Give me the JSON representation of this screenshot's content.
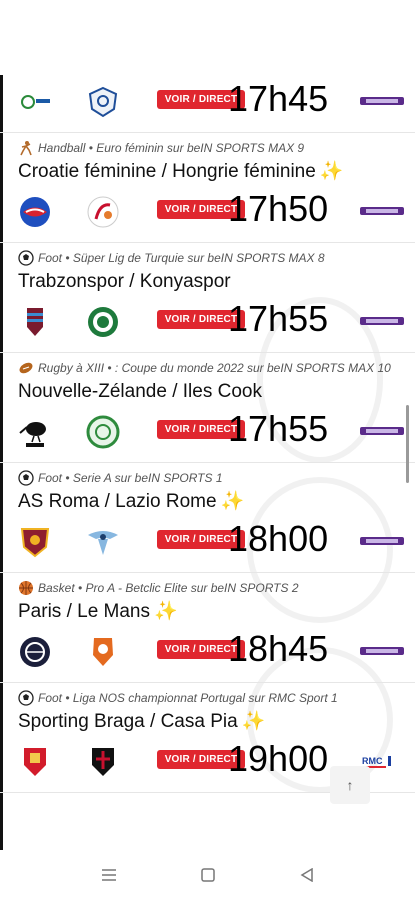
{
  "colors": {
    "accent": "#e0262f",
    "star": "#f2c200"
  },
  "first_row": {
    "button_label": "VOIR / DIRECT",
    "time": "17h45",
    "home_logo_icon": "club-crest-icon",
    "away_logo_icon": "crest-icon",
    "channel_icon": "bein-sports-icon"
  },
  "matches": [
    {
      "sport_icon": "handball-icon",
      "meta": "Handball • Euro féminin sur beIN SPORTS MAX 9",
      "teams": "Croatie féminine / Hongrie féminine",
      "star": "✨",
      "button_label": "VOIR / DIRECT",
      "time": "17h50",
      "home_logo_icon": "croatia-federation-icon",
      "away_logo_icon": "hungary-handball-icon",
      "channel_icon": "bein-sports-icon"
    },
    {
      "sport_icon": "football-icon",
      "meta": "Foot • Süper Lig de Turquie sur beIN SPORTS MAX 8",
      "teams": "Trabzonspor / Konyaspor",
      "star": "",
      "button_label": "VOIR / DIRECT",
      "time": "17h55",
      "home_logo_icon": "trabzonspor-crest-icon",
      "away_logo_icon": "konyaspor-crest-icon",
      "channel_icon": "bein-sports-icon"
    },
    {
      "sport_icon": "rugby-icon",
      "meta": "Rugby à XIII • : Coupe du monde 2022 sur beIN SPORTS MAX 10",
      "teams": "Nouvelle-Zélande / Iles Cook",
      "star": "",
      "button_label": "VOIR / DIRECT",
      "time": "17h55",
      "home_logo_icon": "kiwis-logo-icon",
      "away_logo_icon": "cook-islands-crest-icon",
      "channel_icon": "bein-sports-icon"
    },
    {
      "sport_icon": "football-icon",
      "meta": "Foot • Serie A sur beIN SPORTS 1",
      "teams": "AS Roma / Lazio Rome",
      "star": "✨",
      "button_label": "VOIR / DIRECT",
      "time": "18h00",
      "home_logo_icon": "as-roma-crest-icon",
      "away_logo_icon": "lazio-eagle-icon",
      "channel_icon": "bein-sports-icon"
    },
    {
      "sport_icon": "basketball-icon",
      "meta": "Basket • Pro A - Betclic Elite sur beIN SPORTS 2",
      "teams": "Paris / Le Mans",
      "star": "✨",
      "button_label": "VOIR / DIRECT",
      "time": "18h45",
      "home_logo_icon": "paris-basketball-icon",
      "away_logo_icon": "le-mans-basket-icon",
      "channel_icon": "bein-sports-icon"
    },
    {
      "sport_icon": "football-icon",
      "meta": "Foot • Liga NOS championnat Portugal sur RMC Sport 1",
      "teams": "Sporting Braga / Casa Pia",
      "star": "✨",
      "button_label": "VOIR / DIRECT",
      "time": "19h00",
      "home_logo_icon": "braga-crest-icon",
      "away_logo_icon": "casa-pia-crest-icon",
      "channel_icon": "rmc-sport-icon"
    }
  ],
  "scroll_top_icon": "arrow-up-icon",
  "scroll_top_label": "↑",
  "navbar": {
    "recent_icon": "menu-icon",
    "home_icon": "square-home-icon",
    "back_icon": "triangle-back-icon"
  }
}
